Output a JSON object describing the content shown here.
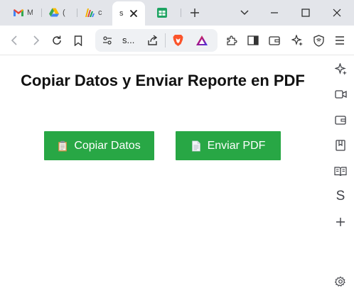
{
  "browser": {
    "tabs": [
      {
        "title": "M",
        "icon": "gmail-icon"
      },
      {
        "title": "(",
        "icon": "google-drive-icon"
      },
      {
        "title": "c",
        "icon": "colorful-app-icon"
      },
      {
        "title": "s",
        "icon": "page-icon",
        "active": true
      },
      {
        "title": "",
        "icon": "google-sheets-icon"
      }
    ],
    "address_text": "s...",
    "toolbar_icons": [
      "back-icon",
      "forward-icon",
      "reload-icon",
      "bookmark-icon",
      "site-settings-icon",
      "share-icon",
      "brave-shields-icon",
      "brave-rewards-icon",
      "extensions-icon",
      "sidebar-icon",
      "wallet-icon",
      "leo-ai-icon",
      "vpn-icon",
      "menu-icon"
    ],
    "sidebar": {
      "items": [
        {
          "icon": "leo-ai-icon"
        },
        {
          "icon": "video-call-icon"
        },
        {
          "icon": "wallet-icon"
        },
        {
          "icon": "bookmarks-icon"
        },
        {
          "icon": "reading-list-icon"
        },
        {
          "label": "S",
          "icon": "s-app-icon"
        },
        {
          "icon": "add-icon"
        },
        {
          "icon": "settings-icon"
        }
      ]
    }
  },
  "page": {
    "title": "Copiar Datos y Enviar Reporte en PDF",
    "buttons": {
      "copy_label": "Copiar Datos",
      "pdf_label": "Enviar PDF"
    }
  },
  "colors": {
    "button_green": "#28a745",
    "tabstrip": "#e3e5ea"
  }
}
